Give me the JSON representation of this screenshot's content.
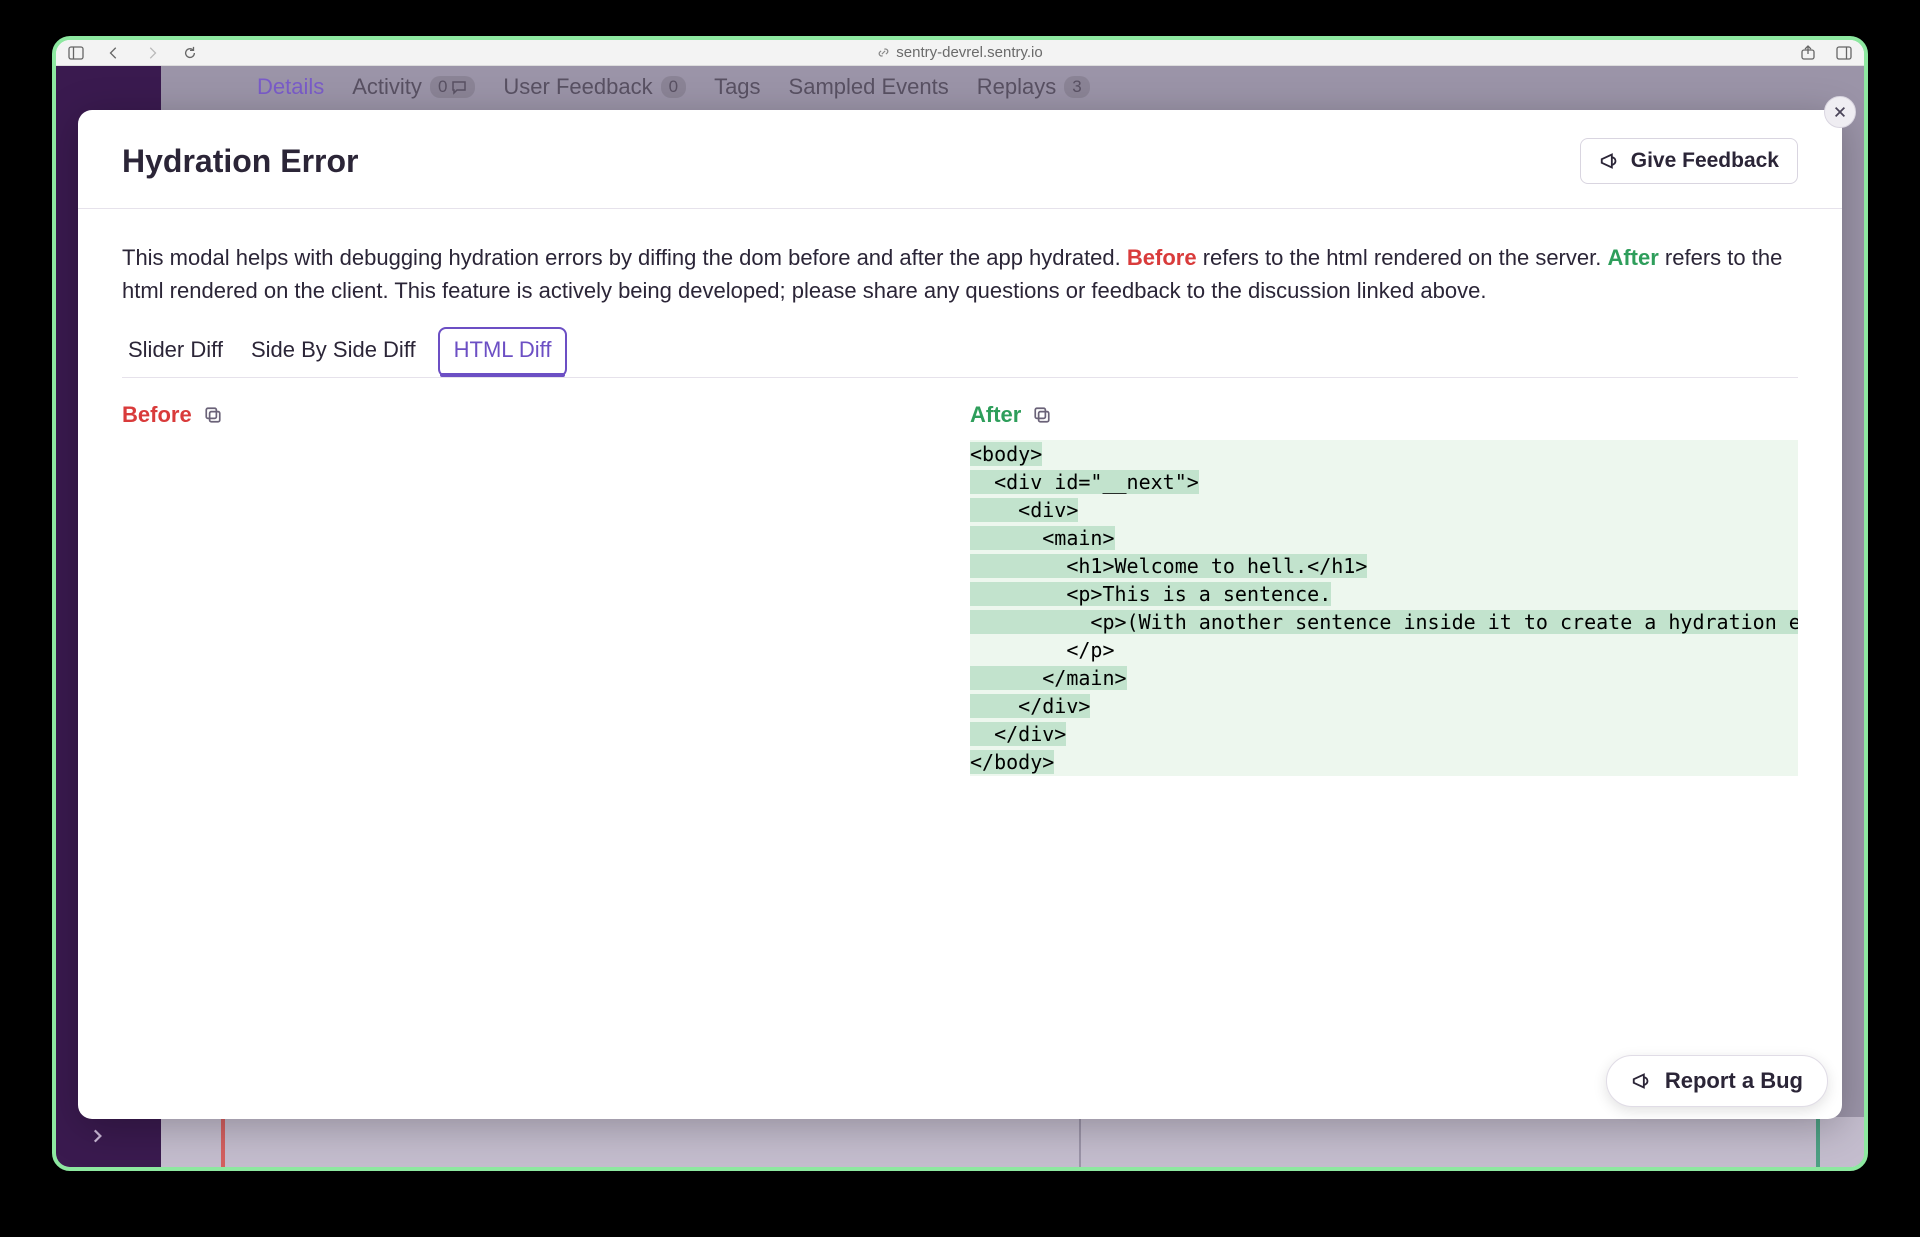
{
  "browser": {
    "url": "sentry-devrel.sentry.io"
  },
  "bg_tabs": {
    "details": "Details",
    "activity": "Activity",
    "activity_count": "0",
    "user_feedback": "User Feedback",
    "user_feedback_count": "0",
    "tags": "Tags",
    "sampled_events": "Sampled Events",
    "replays": "Replays",
    "replays_count": "3"
  },
  "modal": {
    "title": "Hydration Error",
    "feedback_label": "Give Feedback",
    "description_pre": "This modal helps with debugging hydration errors by diffing the dom before and after the app hydrated. ",
    "before_word": "Before",
    "description_mid": " refers to the html rendered on the server. ",
    "after_word": "After",
    "description_post": " refers to the html rendered on the client. This feature is actively being developed; please share any questions or feedback to the discussion linked above."
  },
  "diff_tabs": {
    "slider": "Slider Diff",
    "sidebyside": "Side By Side Diff",
    "html": "HTML Diff"
  },
  "panes": {
    "before_label": "Before",
    "after_label": "After"
  },
  "after_code": {
    "l1": "<body>",
    "l2": "  <div id=\"__next\">",
    "l3": "    <div>",
    "l4": "      <main>",
    "l5": "        <h1>Welcome to hell.</h1>",
    "l6": "        <p>This is a sentence.",
    "l7a": "          <p>(With another sentence inside it to create a hydration error.)",
    "l7b": "</p>",
    "l8": "        </p>",
    "l9": "      </main>",
    "l10": "    </div>",
    "l11": "  </div>",
    "l12": "</body>"
  },
  "report_bug": "Report a Bug"
}
